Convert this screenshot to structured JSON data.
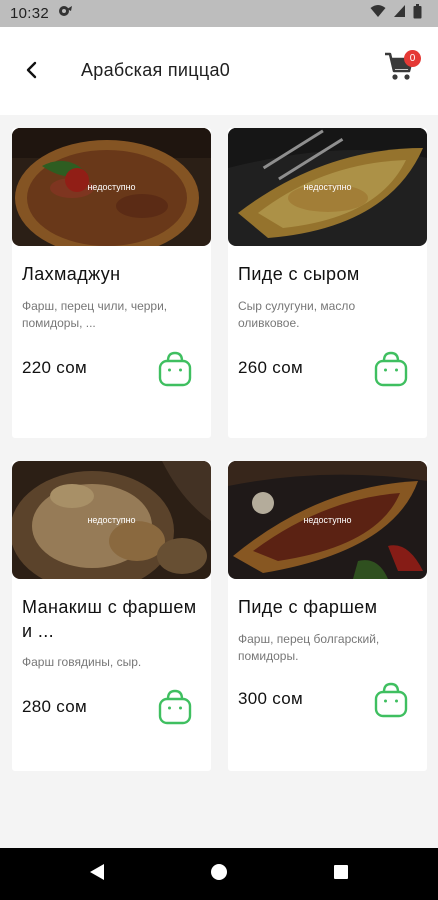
{
  "status_bar": {
    "time": "10:32"
  },
  "header": {
    "title": "Арабская пицца0",
    "cart_count": "0"
  },
  "products": [
    {
      "name": "Лахмаджун",
      "description": "Фарш, перец чили, черри, помидоры, ...",
      "price": "220 сом",
      "status": "недоступно"
    },
    {
      "name": "Пиде с сыром",
      "description": "Сыр сулугуни, масло оливковое.",
      "price": "260 сом",
      "status": "недоступно"
    },
    {
      "name": "Манакиш с фаршем и ...",
      "description": "Фарш говядины, сыр.",
      "price": "280 сом",
      "status": "недоступно"
    },
    {
      "name": "Пиде с фаршем",
      "description": "Фарш, перец болгарский, помидоры.",
      "price": "300 сом",
      "status": "недоступно"
    }
  ],
  "colors": {
    "accent": "#3fbf60",
    "badge": "#e53935",
    "nav_bar": "#000000",
    "status_bar": "#bdbdbd"
  },
  "icons": {
    "back": "back-arrow-icon",
    "cart": "shopping-cart-icon",
    "add": "shopping-bag-icon"
  }
}
